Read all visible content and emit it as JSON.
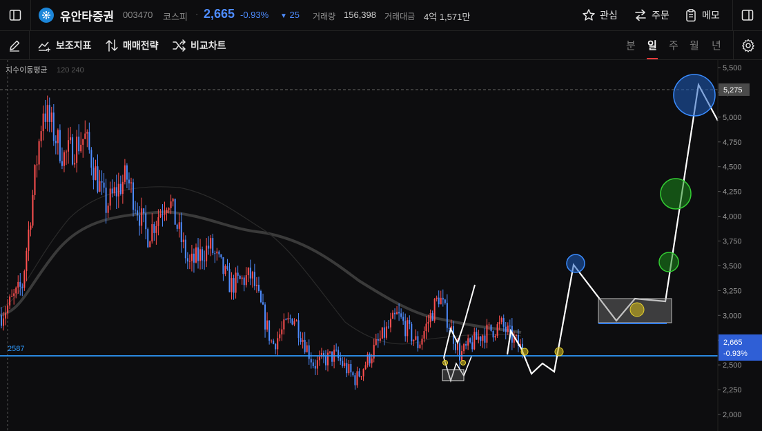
{
  "header": {
    "name": "유안타증권",
    "code": "003470",
    "market": "코스피",
    "separator": "·",
    "price": "2,665",
    "change_rate": "-0.93%",
    "change_arrow": "▼",
    "change": "25",
    "volume_label": "거래량",
    "volume": "156,398",
    "amount_label": "거래대금",
    "amount": "4억 1,571만",
    "actions": {
      "watch": "관심",
      "order": "주문",
      "memo": "메모"
    }
  },
  "toolbar": {
    "indicators": "보조지표",
    "strategy": "매매전략",
    "compare": "비교차트",
    "periods": [
      "분",
      "일",
      "주",
      "월",
      "년"
    ],
    "active_period": "일"
  },
  "chart_data": {
    "type": "candlestick",
    "ma_label": "지수이동평균",
    "ma_periods": "120 240",
    "ylim": [
      1950,
      5550
    ],
    "y_ticks": [
      "5,500",
      "5,250",
      "5,000",
      "4,750",
      "4,500",
      "4,250",
      "4,000",
      "3,750",
      "3,500",
      "3,250",
      "3,000",
      "2,750",
      "2,500",
      "2,250",
      "2,000"
    ],
    "crosshair_price": "5,275",
    "current_price": "2,665",
    "current_rate": "-0.93%",
    "support_label": "2587",
    "support_level": 2587,
    "price_path_approx": [
      3000,
      3300,
      5100,
      4600,
      4800,
      4100,
      4400,
      3800,
      4200,
      3500,
      3700,
      3300,
      3400,
      2700,
      3000,
      2500,
      2600,
      2350,
      2700,
      3000,
      2700,
      3200,
      2600,
      2800,
      2900,
      2650
    ],
    "colors": {
      "up": "#ff5050",
      "down": "#4e8cff",
      "support": "#2f9bff",
      "price_label_bg": "#2f5fd6"
    }
  }
}
